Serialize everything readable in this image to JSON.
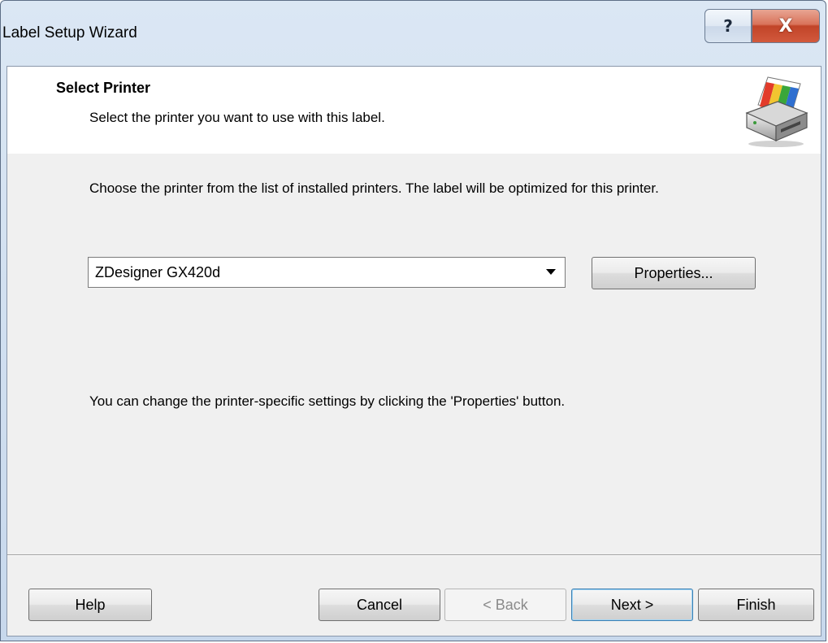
{
  "window": {
    "title": "Label Setup Wizard",
    "help_glyph": "?",
    "close_glyph": "X"
  },
  "header": {
    "title": "Select Printer",
    "subtitle": "Select the printer you want to use with this label.",
    "icon": "printer-icon"
  },
  "body": {
    "description": "Choose the printer from the list of installed printers. The label will be optimized for this printer.",
    "printer_select": {
      "selected": "ZDesigner GX420d"
    },
    "properties_button": "Properties...",
    "hint": "You can change the printer-specific settings by clicking the 'Properties' button."
  },
  "footer": {
    "help": "Help",
    "cancel": "Cancel",
    "back": "< Back",
    "next": "Next >",
    "finish": "Finish"
  },
  "colors": {
    "close_button": "#c14428",
    "dialog_background": "#f0f0f0",
    "header_background": "#ffffff"
  }
}
